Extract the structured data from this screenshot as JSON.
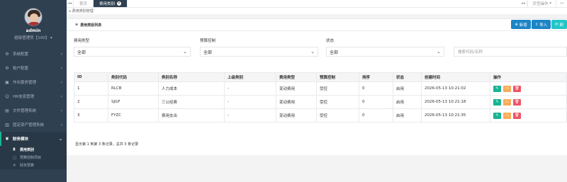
{
  "user": {
    "name": "admin",
    "role": "超级管理员【100】"
  },
  "sidebar": {
    "items": [
      {
        "label": "系统配置",
        "icon": "gear-icon"
      },
      {
        "label": "租户配置",
        "icon": "gear-icon"
      },
      {
        "label": "作业服务管理",
        "icon": "briefcase-icon"
      },
      {
        "label": "HR信息管理",
        "icon": "user-icon"
      },
      {
        "label": "文件管理系统",
        "icon": "folder-icon"
      },
      {
        "label": "固定资产管理系统",
        "icon": "archive-icon"
      },
      {
        "label": "财务模块",
        "icon": "money-icon"
      }
    ],
    "sub_items": [
      {
        "label": "费用类别"
      },
      {
        "label": "预算控制项目"
      },
      {
        "label": "财务预算"
      }
    ]
  },
  "topbar": {
    "tabs": [
      "首页",
      "费用类别"
    ],
    "page_ops": "页签操作"
  },
  "breadcrumb": "费用类别管理",
  "panel": {
    "title": "费用类别列表",
    "btn_add": "新增",
    "btn_import": "导入",
    "btn_refresh": "刷"
  },
  "filters": {
    "type_label": "费用类型",
    "type_value": "全部",
    "budget_label": "预算控制",
    "budget_value": "全部",
    "status_label": "状态",
    "status_value": "全部",
    "search_placeholder": "搜索代码/名称"
  },
  "table": {
    "headers": [
      "ID",
      "类别代码",
      "类别名称",
      "上级类别",
      "费用类型",
      "预算控制",
      "排序",
      "状态",
      "创建时间",
      "操作"
    ],
    "rows": [
      [
        "1",
        "RLCB",
        "人力成本",
        "-",
        "变动费用",
        "受控",
        "0",
        "启用",
        "2026-05-13 10:21:02"
      ],
      [
        "2",
        "SJGF",
        "三公经费",
        "-",
        "变动费用",
        "受控",
        "0",
        "启用",
        "2026-05-13 10:21:18"
      ],
      [
        "3",
        "FYZC",
        "费用支出",
        "-",
        "变动费用",
        "受控",
        "0",
        "启用",
        "2026-05-13 10:21:35"
      ]
    ]
  },
  "summary": "显示第 1 到第 3 条记录，总共 3 条记录",
  "colors": {
    "sidebar": "#2f4050",
    "primary": "#1c84c6",
    "edit": "#1ab394",
    "lock": "#f8ac59",
    "delete": "#ed5565"
  }
}
